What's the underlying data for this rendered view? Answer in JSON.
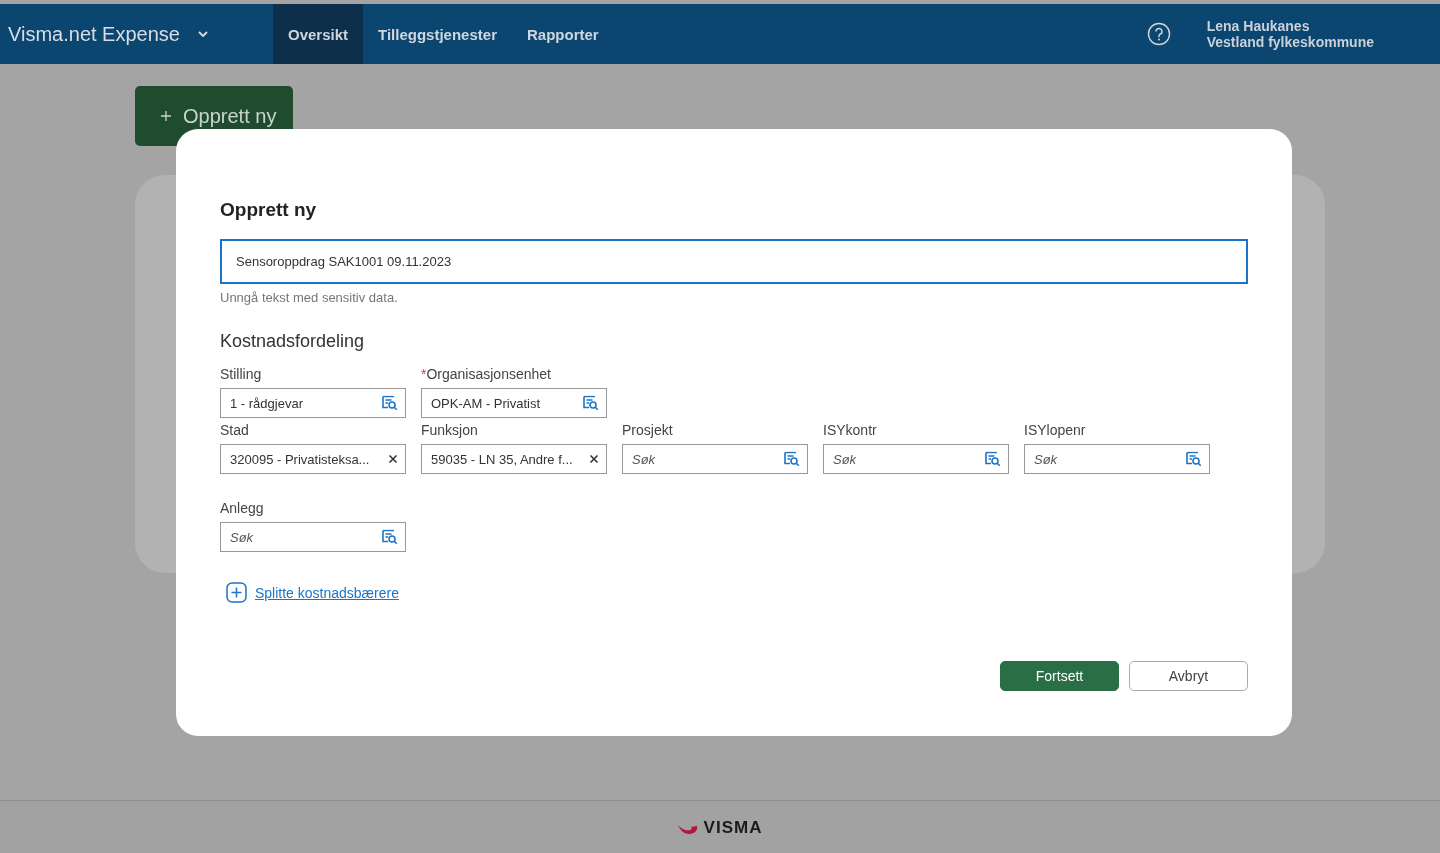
{
  "header": {
    "app_title": "Visma.net Expense",
    "nav": [
      {
        "label": "Oversikt",
        "selected": true
      },
      {
        "label": "Tilleggstjenester",
        "selected": false
      },
      {
        "label": "Rapporter",
        "selected": false
      }
    ],
    "user_name": "Lena Haukanes",
    "organization": "Vestland fylkeskommune"
  },
  "page": {
    "create_button": "Opprett ny"
  },
  "dialog": {
    "title": "Opprett ny",
    "name_value": "Sensoroppdrag SAK1001 09.11.2023",
    "hint": "Unngå tekst med sensitiv data.",
    "section_title": "Kostnadsfordeling",
    "required_mark": "*",
    "field_rows": [
      [
        {
          "label": "Stilling",
          "required": false,
          "value": "1 - rådgjevar",
          "kind": "search"
        },
        {
          "label": "Organisasjonsenhet",
          "required": true,
          "value": "OPK-AM - Privatist",
          "kind": "search"
        }
      ],
      [
        {
          "label": "Stad",
          "required": false,
          "value": "320095 - Privatisteksa...",
          "kind": "clear"
        },
        {
          "label": "Funksjon",
          "required": false,
          "value": "59035 - LN 35, Andre f...",
          "kind": "clear"
        },
        {
          "label": "Prosjekt",
          "required": false,
          "placeholder": "Søk",
          "kind": "search"
        },
        {
          "label": "ISYkontr",
          "required": false,
          "placeholder": "Søk",
          "kind": "search"
        },
        {
          "label": "ISYlopenr",
          "required": false,
          "placeholder": "Søk",
          "kind": "search"
        }
      ],
      [
        {
          "label": "Anlegg",
          "required": false,
          "placeholder": "Søk",
          "kind": "search"
        }
      ]
    ],
    "split_link": "Splitte kostnadsbærere",
    "buttons": [
      {
        "label": "Fortsett",
        "kind": "primary"
      },
      {
        "label": "Avbryt",
        "kind": "secondary"
      }
    ]
  },
  "footer": {
    "logo_text": "VISMA"
  }
}
